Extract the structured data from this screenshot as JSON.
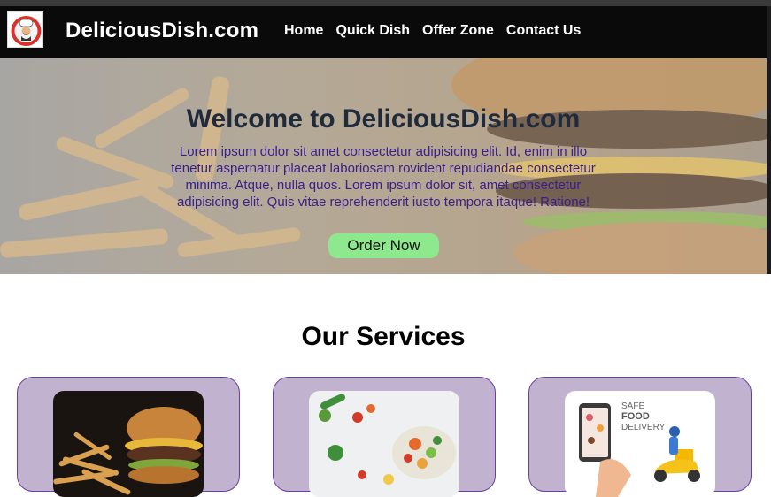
{
  "header": {
    "brand": "DeliciousDish.com",
    "nav": [
      "Home",
      "Quick Dish",
      "Offer Zone",
      "Contact Us"
    ]
  },
  "hero": {
    "title": "Welcome to DeliciousDish.com",
    "text": "Lorem ipsum dolor sit amet consectetur adipisicing elit. Id, enim in illo tenetur aspernatur placeat laboriosam rovident repudiandae consectetur minima. Atque, nulla quos. Lorem ipsum dolor sit, amet consectetur adipisicing elit. Quis vitae reprehenderit iusto tempora itaque! Ratione!",
    "cta": "Order Now"
  },
  "services": {
    "title": "Our Services",
    "cards": [
      {
        "image": "burger-fries-photo"
      },
      {
        "image": "salad-bowl-photo"
      },
      {
        "image": "food-delivery-illustration",
        "caption": "SAFE FOOD DELIVERY"
      }
    ]
  },
  "colors": {
    "navbar": "#0a0a0a",
    "hero_title": "#1f2a3a",
    "hero_text": "#3a1f8a",
    "cta": "#8ee88e",
    "card_bg": "#c1b3cf",
    "card_border": "#6a3fa0"
  }
}
